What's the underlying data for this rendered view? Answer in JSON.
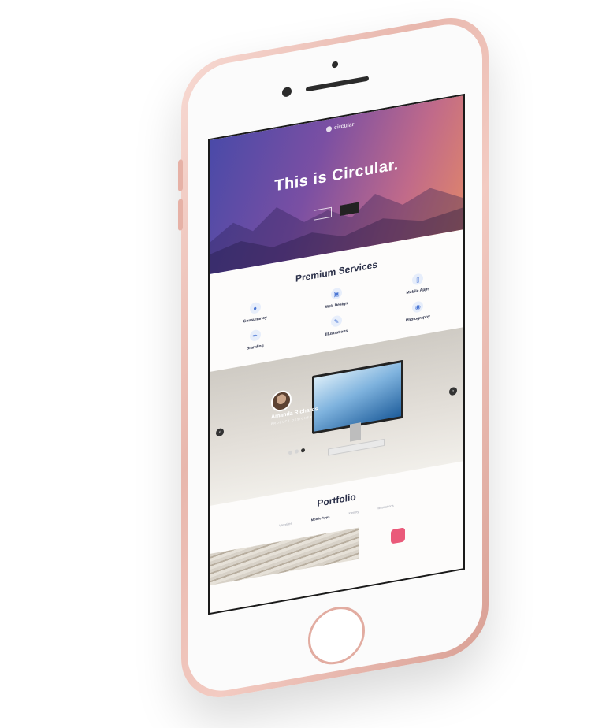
{
  "hero": {
    "nav_items": [
      "",
      "",
      "",
      "",
      ""
    ],
    "logo": "circular",
    "nav_cta": "",
    "title": "This is Circular.",
    "subtitle": "",
    "buttons": [
      "",
      ""
    ]
  },
  "services": {
    "title": "Premium Services",
    "items": [
      {
        "title": "Consultancy",
        "icon": "bulb-icon"
      },
      {
        "title": "Web Design",
        "icon": "monitor-icon"
      },
      {
        "title": "Mobile Apps",
        "icon": "mobile-icon"
      },
      {
        "title": "Branding",
        "icon": "pen-icon"
      },
      {
        "title": "Illustrations",
        "icon": "brush-icon"
      },
      {
        "title": "Photography",
        "icon": "camera-icon"
      }
    ]
  },
  "testimonial": {
    "name": "Amanda Richards",
    "role": "PRODUCT DESIGNER",
    "quote": ""
  },
  "portfolio": {
    "title": "Portfolio",
    "filters": [
      "Websites",
      "Mobile Apps",
      "Identity",
      "Illustrations"
    ]
  }
}
